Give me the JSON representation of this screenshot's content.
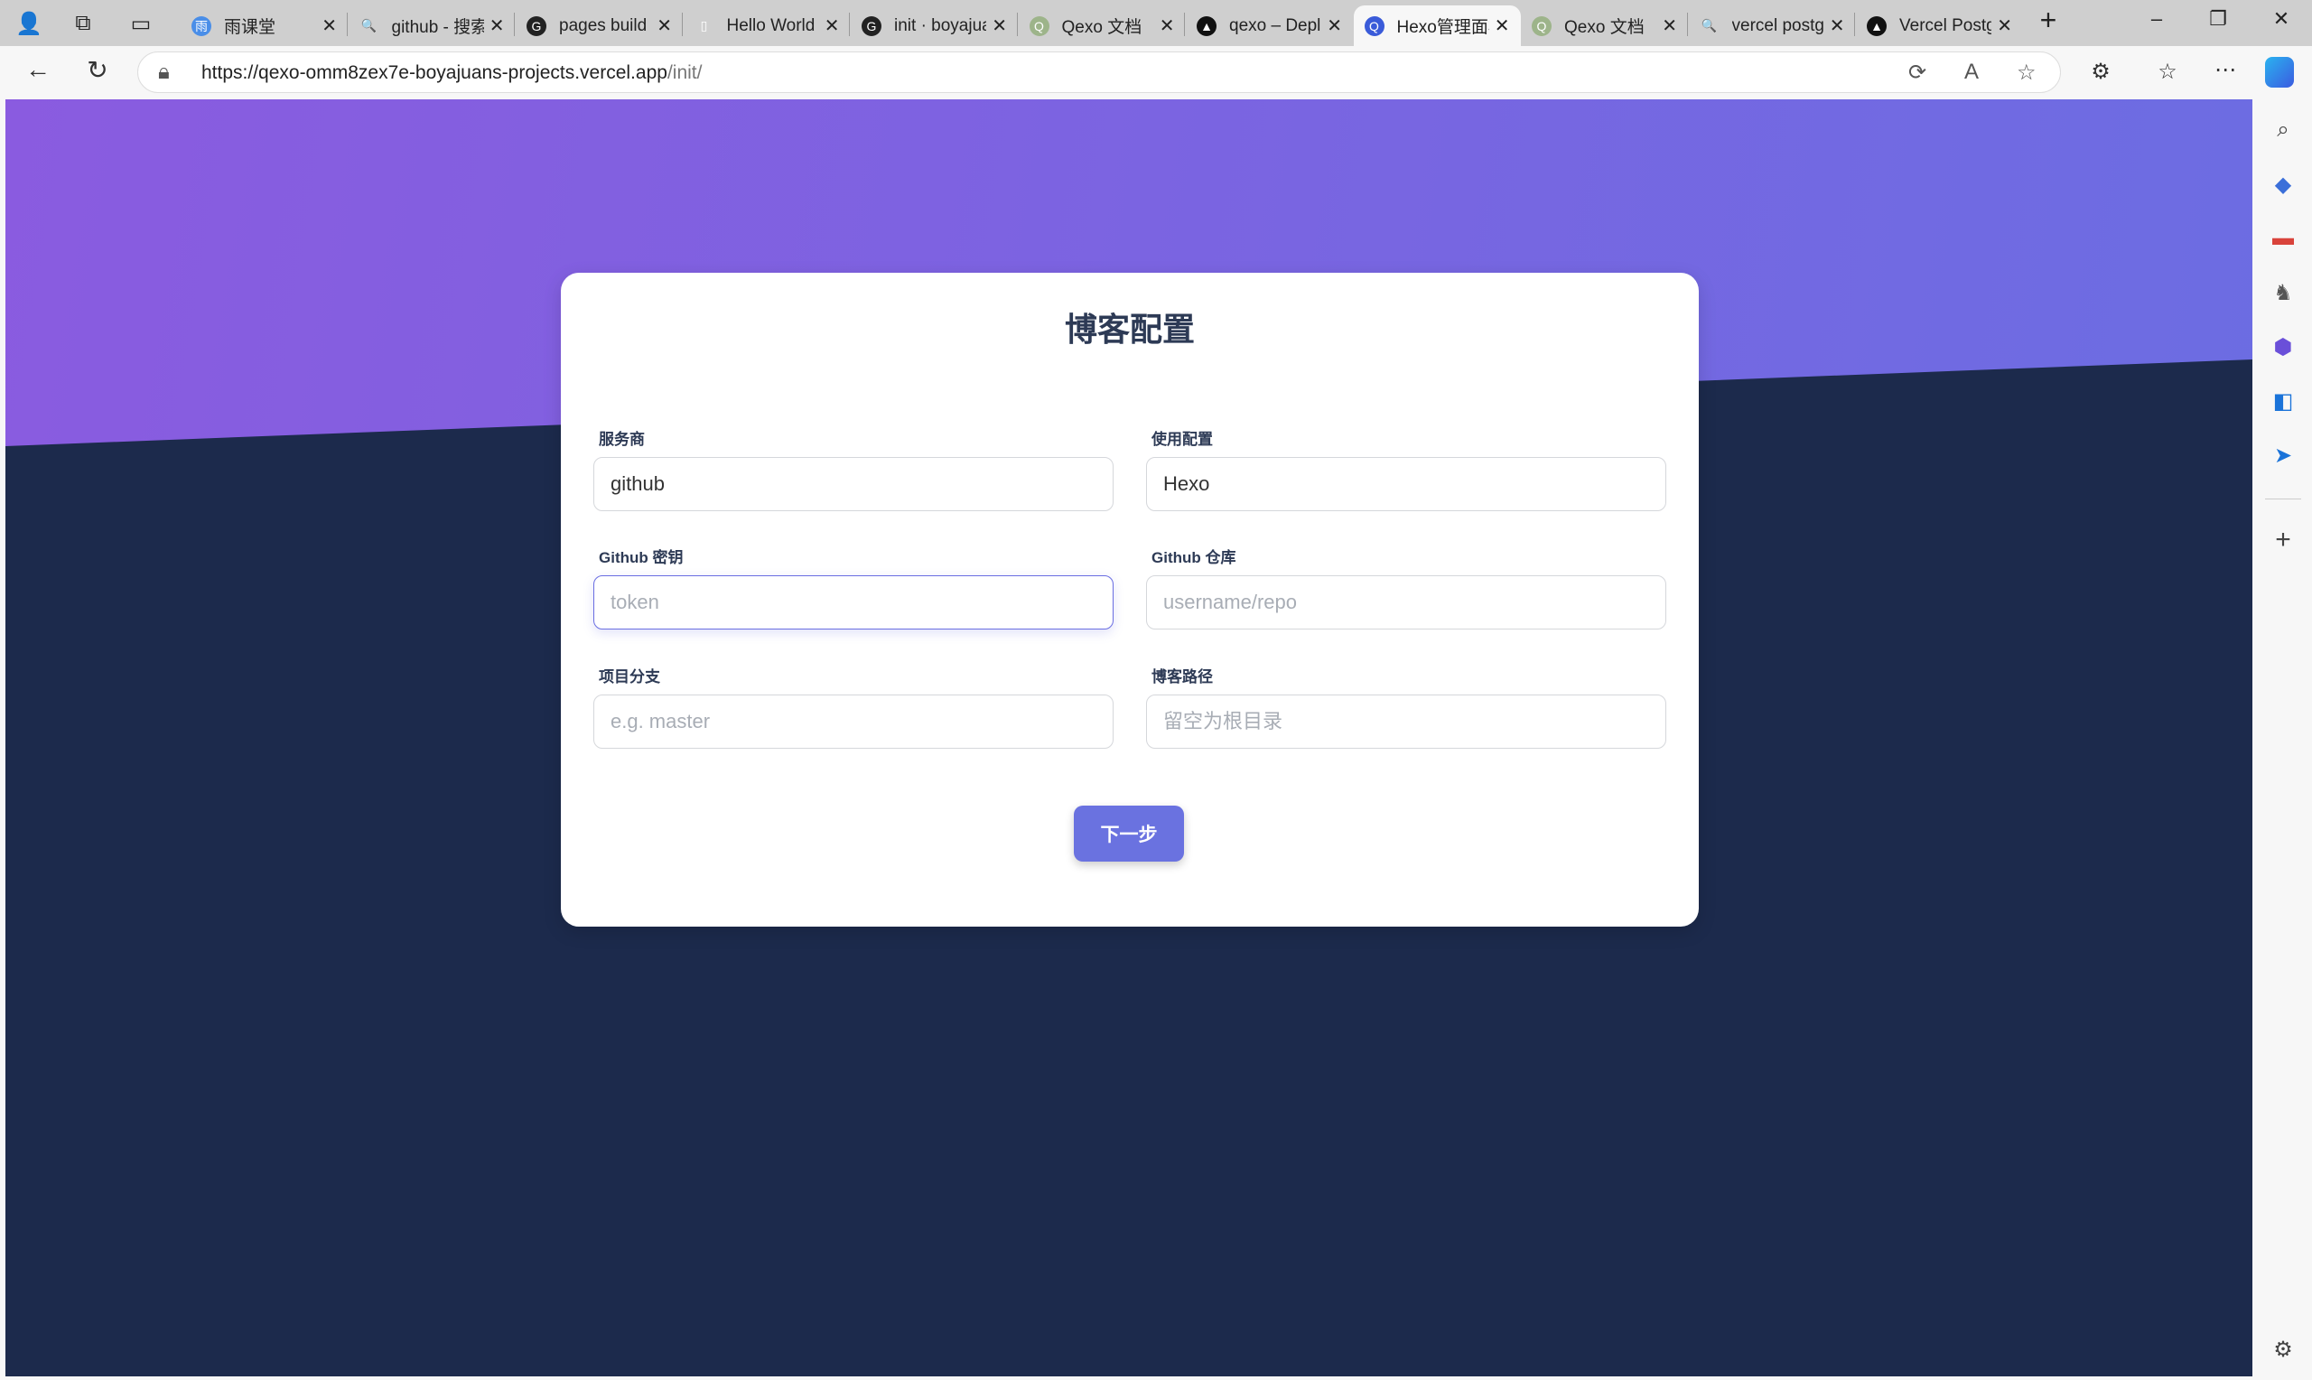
{
  "tabs": [
    {
      "title": "雨课堂",
      "fav": "雨",
      "color": "#4a8ee8"
    },
    {
      "title": "github - 搜索",
      "fav": "🔍",
      "color": "#cfcfcf"
    },
    {
      "title": "pages build",
      "fav": "G",
      "color": "#222"
    },
    {
      "title": "Hello World",
      "fav": "▯",
      "color": "#cfcfcf"
    },
    {
      "title": "init · boyajuans",
      "fav": "G",
      "color": "#222"
    },
    {
      "title": "Qexo 文档",
      "fav": "Q",
      "color": "#9db48a"
    },
    {
      "title": "qexo – Deploy",
      "fav": "▲",
      "color": "#111"
    },
    {
      "title": "Hexo管理面板",
      "fav": "Q",
      "color": "#3a5bd9"
    },
    {
      "title": "Qexo 文档",
      "fav": "Q",
      "color": "#9db48a"
    },
    {
      "title": "vercel postgres",
      "fav": "🔍",
      "color": "#cfcfcf"
    },
    {
      "title": "Vercel Postgres",
      "fav": "▲",
      "color": "#111"
    }
  ],
  "address": {
    "url_main": "https://qexo-omm8zex7e-boyajuans-projects.vercel.app",
    "url_path": "/init/"
  },
  "form": {
    "title": "博客配置",
    "provider_label": "服务商",
    "provider_value": "github",
    "config_label": "使用配置",
    "config_value": "Hexo",
    "token_label": "Github 密钥",
    "token_placeholder": "token",
    "repo_label": "Github 仓库",
    "repo_placeholder": "username/repo",
    "branch_label": "项目分支",
    "branch_placeholder": "e.g. master",
    "path_label": "博客路径",
    "path_placeholder": "留空为根目录",
    "next_label": "下一步"
  }
}
